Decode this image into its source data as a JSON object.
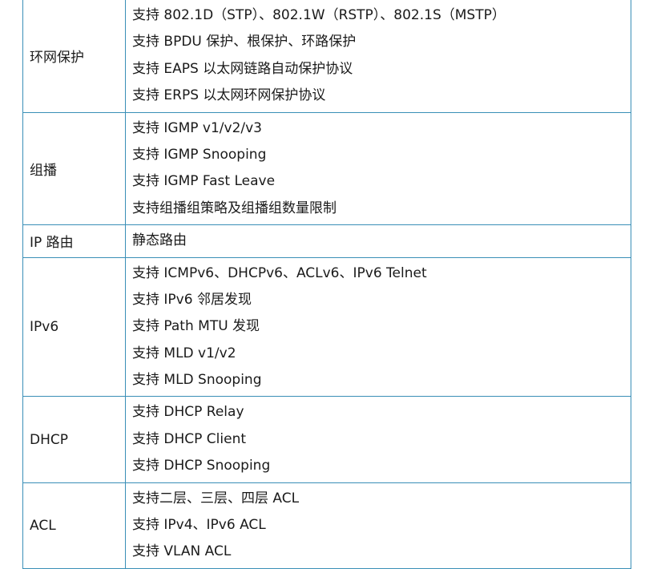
{
  "spec_rows": [
    {
      "category": "环网保护",
      "items": [
        "支持 802.1D（STP）、802.1W（RSTP）、802.1S（MSTP）",
        "支持 BPDU 保护、根保护、环路保护",
        "支持 EAPS 以太网链路自动保护协议",
        "支持 ERPS 以太网环网保护协议"
      ]
    },
    {
      "category": "组播",
      "items": [
        "支持 IGMP v1/v2/v3",
        "支持 IGMP Snooping",
        "支持 IGMP Fast Leave",
        "支持组播组策略及组播组数量限制"
      ]
    },
    {
      "category": "IP 路由",
      "items": [
        "静态路由"
      ]
    },
    {
      "category": "IPv6",
      "items": [
        "支持 ICMPv6、DHCPv6、ACLv6、IPv6 Telnet",
        "支持 IPv6 邻居发现",
        "支持 Path MTU 发现",
        "支持 MLD v1/v2",
        "支持 MLD Snooping"
      ]
    },
    {
      "category": "DHCP",
      "items": [
        "支持 DHCP Relay",
        "支持 DHCP Client",
        "支持 DHCP Snooping"
      ]
    },
    {
      "category": "ACL",
      "items": [
        "支持二层、三层、四层 ACL",
        "支持 IPv4、IPv6 ACL",
        "支持 VLAN ACL"
      ]
    }
  ],
  "colors": {
    "border": "#3a8fb7",
    "text": "#1a1a1a",
    "background": "#ffffff"
  }
}
